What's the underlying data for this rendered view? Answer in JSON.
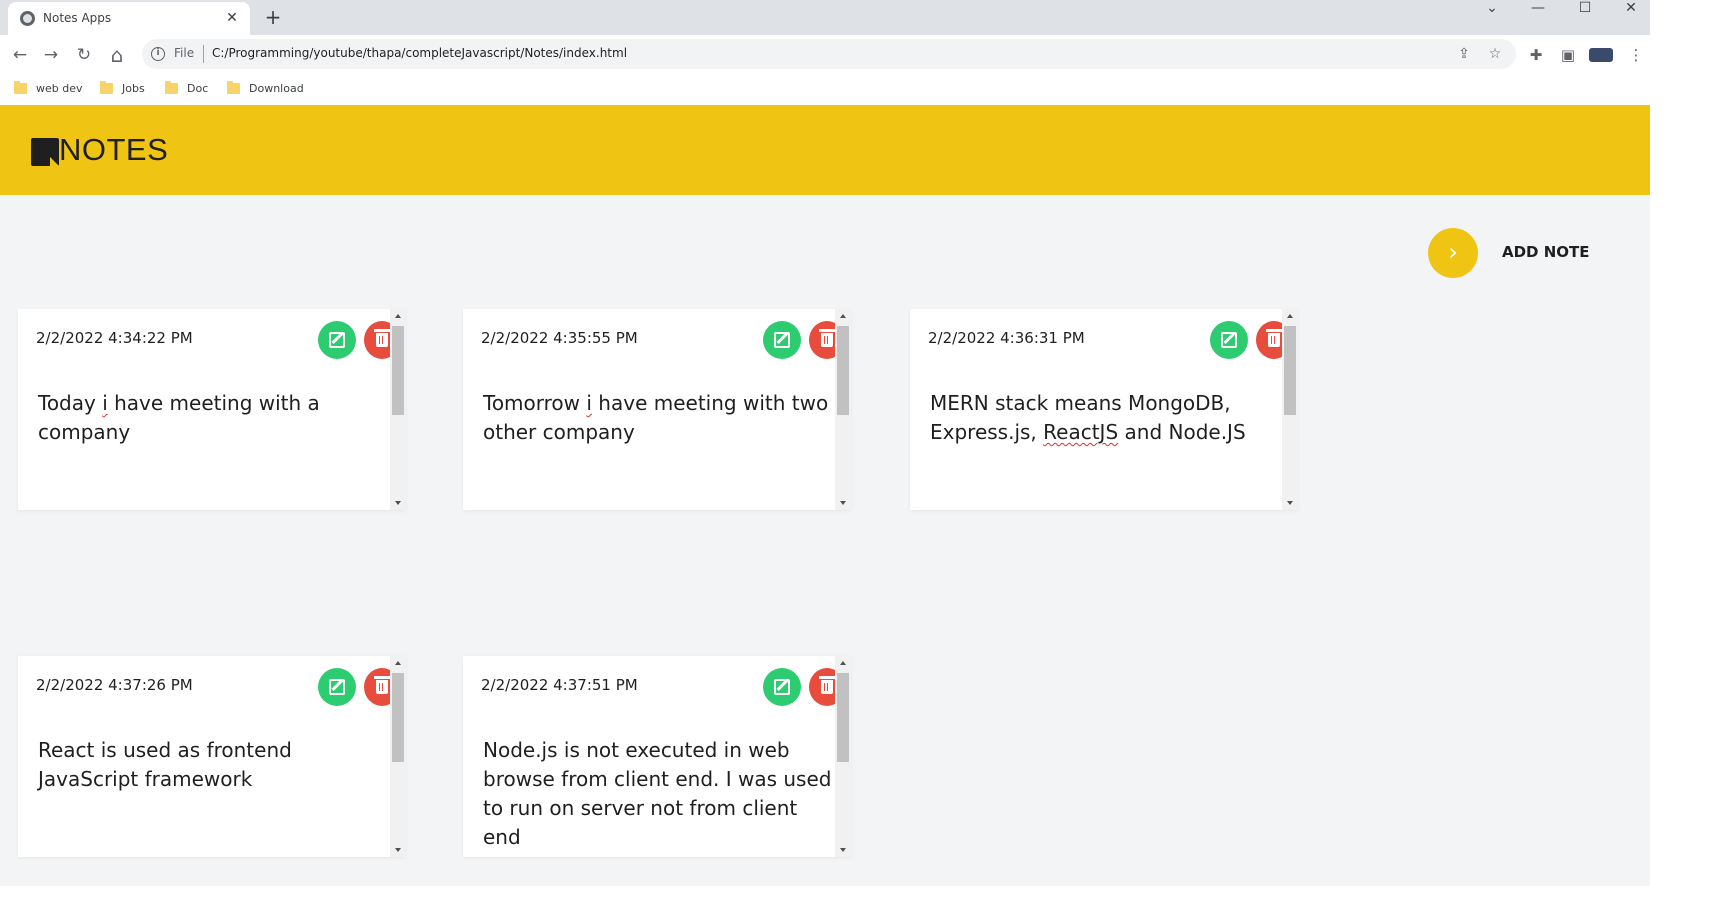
{
  "browser": {
    "tab_title": "Notes Apps",
    "tab_close": "✕",
    "new_tab": "+",
    "window_controls": [
      "⌄",
      "—",
      "☐",
      "✕"
    ],
    "nav": {
      "back": "←",
      "forward": "→",
      "reload": "↻",
      "home": "⌂"
    },
    "omnibox": {
      "scheme_label": "File",
      "url": "C:/Programming/youtube/thapa/completeJavascript/Notes/index.html"
    },
    "bookmarks": [
      "web dev",
      "Jobs",
      "Doc",
      "Download"
    ]
  },
  "app": {
    "logo_text": "NOTES",
    "add_note_icon": "›",
    "add_note_label": "ADD NOTE",
    "accent_color": "#f0c413",
    "edit_color": "#2ecc71",
    "delete_color": "#e74c3c"
  },
  "notes": [
    {
      "timestamp": "2/2/2022 4:34:22 PM",
      "text_parts": [
        "Today ",
        "i",
        " have meeting with a company"
      ]
    },
    {
      "timestamp": "2/2/2022 4:35:55 PM",
      "text_parts": [
        "Tomorrow ",
        "i",
        " have meeting with two other company"
      ]
    },
    {
      "timestamp": "2/2/2022 4:36:31 PM",
      "text_parts": [
        "MERN stack means MongoDB, Express.js, ",
        "ReactJS",
        " and Node.JS"
      ]
    },
    {
      "timestamp": "2/2/2022 4:37:26 PM",
      "text_parts": [
        "React is used as frontend JavaScript framework",
        "",
        ""
      ]
    },
    {
      "timestamp": "2/2/2022 4:37:51 PM",
      "text_parts": [
        "Node.js is not executed in web browse from client end.  I was used to run on server not from client end",
        "",
        ""
      ]
    }
  ]
}
